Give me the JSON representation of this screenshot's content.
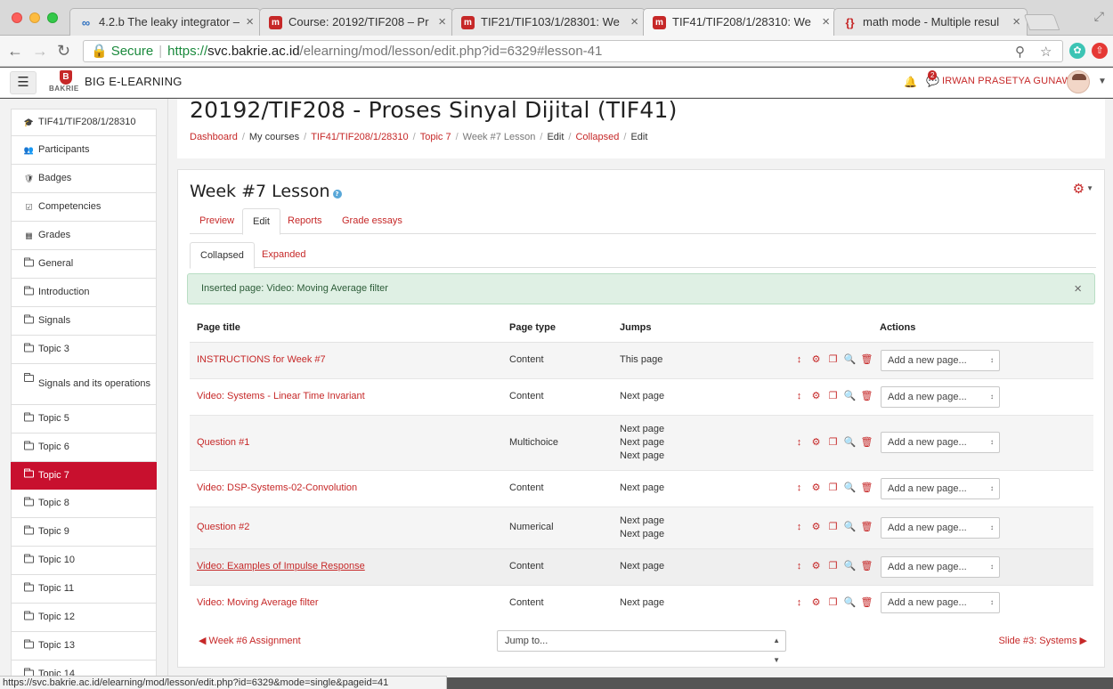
{
  "browser": {
    "tabs": [
      {
        "title": "4.2.b The leaky integrator –",
        "icon": "coursera-icon"
      },
      {
        "title": "Course: 20192/TIF208 – Pr",
        "icon": "moodle-icon"
      },
      {
        "title": "TIF21/TIF103/1/28301: We",
        "icon": "moodle-icon"
      },
      {
        "title": "TIF41/TIF208/1/28310: We",
        "icon": "moodle-icon"
      },
      {
        "title": "math mode - Multiple resul",
        "icon": "tex-icon"
      }
    ],
    "secure_label": "Secure",
    "url_scheme": "https://",
    "url_host": "svc.bakrie.ac.id",
    "url_path": "/elearning/mod/lesson/edit.php?id=6329#lesson-41",
    "status_url": "https://svc.bakrie.ac.id/elearning/mod/lesson/edit.php?id=6329&mode=single&pageid=41"
  },
  "header": {
    "logo_word": "BAKRIE",
    "site_name": "BIG E-LEARNING",
    "message_count": "2",
    "user_name": "IRWAN PRASETYA GUNAWAN"
  },
  "nav": {
    "items": [
      {
        "label": "TIF41/TIF208/1/28310",
        "icon": "graduation-cap-icon"
      },
      {
        "label": "Participants",
        "icon": "users-icon"
      },
      {
        "label": "Badges",
        "icon": "shield-icon"
      },
      {
        "label": "Competencies",
        "icon": "checkbox-icon"
      },
      {
        "label": "Grades",
        "icon": "table-icon"
      },
      {
        "label": "General",
        "icon": "folder-icon"
      },
      {
        "label": "Introduction",
        "icon": "folder-icon"
      },
      {
        "label": "Signals",
        "icon": "folder-icon"
      },
      {
        "label": "Topic 3",
        "icon": "folder-icon"
      },
      {
        "label": "Signals and its operations",
        "icon": "folder-icon"
      },
      {
        "label": "Topic 5",
        "icon": "folder-icon"
      },
      {
        "label": "Topic 6",
        "icon": "folder-icon"
      },
      {
        "label": "Topic 7",
        "icon": "folder-icon",
        "active": true
      },
      {
        "label": "Topic 8",
        "icon": "folder-icon"
      },
      {
        "label": "Topic 9",
        "icon": "folder-icon"
      },
      {
        "label": "Topic 10",
        "icon": "folder-icon"
      },
      {
        "label": "Topic 11",
        "icon": "folder-icon"
      },
      {
        "label": "Topic 12",
        "icon": "folder-icon"
      },
      {
        "label": "Topic 13",
        "icon": "folder-icon"
      },
      {
        "label": "Topic 14",
        "icon": "folder-icon"
      }
    ]
  },
  "page": {
    "course_title": "20192/TIF208 - Proses Sinyal Dijital (TIF41)",
    "breadcrumb": [
      "Dashboard",
      "My courses",
      "TIF41/TIF208/1/28310",
      "Topic 7",
      "Week #7 Lesson",
      "Edit",
      "Collapsed",
      "Edit"
    ]
  },
  "lesson": {
    "title": "Week #7 Lesson",
    "tabs": [
      "Preview",
      "Edit",
      "Reports",
      "Grade essays"
    ],
    "subtabs": [
      "Collapsed",
      "Expanded"
    ],
    "alert": "Inserted page: Video: Moving Average filter",
    "columns": [
      "Page title",
      "Page type",
      "Jumps",
      "Actions"
    ],
    "add_page_placeholder": "Add a new page...",
    "rows": [
      {
        "title": "INSTRUCTIONS for Week #7",
        "type": "Content",
        "jumps": [
          "This page"
        ]
      },
      {
        "title": "Video: Systems - Linear Time Invariant",
        "type": "Content",
        "jumps": [
          "Next page"
        ]
      },
      {
        "title": "Question #1",
        "type": "Multichoice",
        "jumps": [
          "Next page",
          "Next page",
          "Next page"
        ]
      },
      {
        "title": "Video: DSP-Systems-02-Convolution",
        "type": "Content",
        "jumps": [
          "Next page"
        ]
      },
      {
        "title": "Question #2",
        "type": "Numerical",
        "jumps": [
          "Next page",
          "Next page"
        ]
      },
      {
        "title": "Video: Examples of Impulse Response",
        "type": "Content",
        "jumps": [
          "Next page"
        ]
      },
      {
        "title": "Video: Moving Average filter",
        "type": "Content",
        "jumps": [
          "Next page"
        ]
      }
    ],
    "prev_link": "Week #6 Assignment",
    "jump_placeholder": "Jump to...",
    "next_link": "Slide #3: Systems"
  }
}
